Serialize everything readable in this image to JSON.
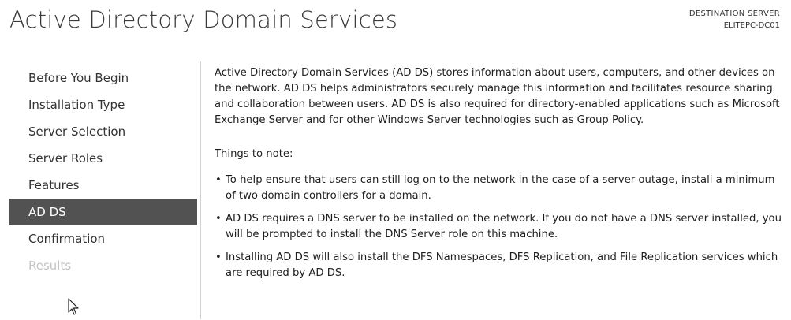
{
  "header": {
    "title": "Active Directory Domain Services",
    "destination_label": "DESTINATION SERVER",
    "destination_value": "ELITEPC-DC01"
  },
  "sidebar": {
    "items": [
      {
        "label": "Before You Begin",
        "state": "normal"
      },
      {
        "label": "Installation Type",
        "state": "normal"
      },
      {
        "label": "Server Selection",
        "state": "normal"
      },
      {
        "label": "Server Roles",
        "state": "normal"
      },
      {
        "label": "Features",
        "state": "normal"
      },
      {
        "label": "AD DS",
        "state": "selected"
      },
      {
        "label": "Confirmation",
        "state": "normal"
      },
      {
        "label": "Results",
        "state": "disabled"
      }
    ]
  },
  "content": {
    "intro": "Active Directory Domain Services (AD DS) stores information about users, computers, and other devices on the network.  AD DS helps administrators securely manage this information and facilitates resource sharing and collaboration between users.  AD DS is also required for directory-enabled applications such as Microsoft Exchange Server and for other Windows Server technologies such as Group Policy.",
    "notes_title": "Things to note:",
    "notes": [
      "To help ensure that users can still log on to the network in the case of a server outage, install a minimum of two domain controllers for a domain.",
      "AD DS requires a DNS server to be installed on the network.  If you do not have a DNS server installed, you will be prompted to install the DNS Server role on this machine.",
      "Installing AD DS will also install the DFS Namespaces, DFS Replication, and File Replication services which are required by AD DS."
    ],
    "bullet": "•"
  },
  "colors": {
    "selected_bg": "#525252",
    "disabled_text": "#c4c4c4",
    "divider": "#d2d2d2"
  },
  "icons": {
    "cursor": "mouse-pointer-icon"
  }
}
